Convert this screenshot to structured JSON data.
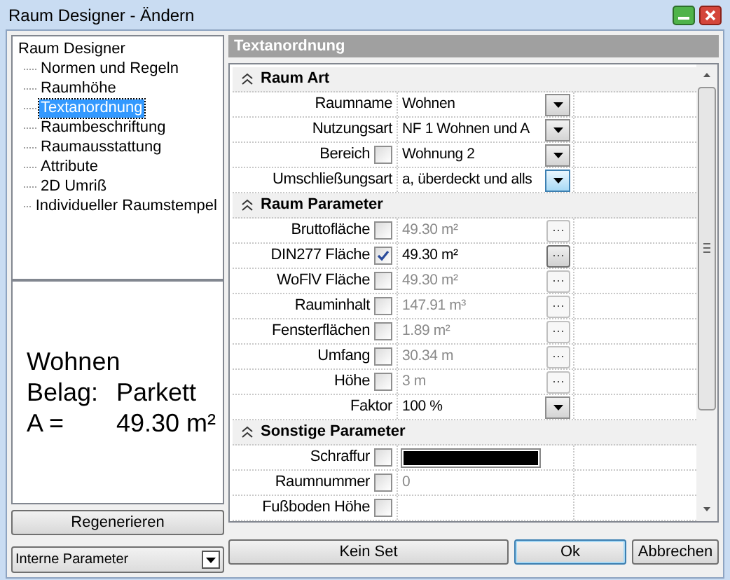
{
  "window": {
    "title": "Raum Designer - Ändern"
  },
  "tree": {
    "label": "Raum Designer",
    "selected": false,
    "children": [
      {
        "label": "Normen und Regeln",
        "selected": false
      },
      {
        "label": "Raumhöhe",
        "selected": false
      },
      {
        "label": "Textanordnung",
        "selected": true
      },
      {
        "label": "Raumbeschriftung",
        "selected": false
      },
      {
        "label": "Raumausstattung",
        "selected": false
      },
      {
        "label": "Attribute",
        "selected": false
      },
      {
        "label": "2D Umriß",
        "selected": false
      },
      {
        "label": "Individueller Raumstempel",
        "selected": false
      }
    ]
  },
  "preview": {
    "lines": [
      [
        "Wohnen"
      ],
      [
        "Belag:",
        "Parkett"
      ],
      [
        "A =",
        "49.30 m²"
      ]
    ]
  },
  "regenerate_button": "Regenerieren",
  "parameter_select": {
    "value": "Interne Parameter"
  },
  "panel_title": "Textanordnung",
  "grid": [
    {
      "kind": "section",
      "label": "Raum Art",
      "expanded": true
    },
    {
      "kind": "dropdown",
      "label": "Raumname",
      "value": "Wohnen",
      "dimmed": false,
      "active": false
    },
    {
      "kind": "dropdown",
      "label": "Nutzungsart",
      "value": "NF 1 Wohnen und A",
      "dimmed": false,
      "active": false
    },
    {
      "kind": "dropdown",
      "label": "Bereich",
      "checked": false,
      "value": "Wohnung 2",
      "dimmed": false,
      "active": false
    },
    {
      "kind": "dropdown",
      "label": "Umschließungsart",
      "value": "a, überdeckt und alls",
      "dimmed": false,
      "active": true
    },
    {
      "kind": "section",
      "label": "Raum Parameter",
      "expanded": true
    },
    {
      "kind": "ellipsis",
      "label": "Bruttofläche",
      "checked": false,
      "value": "49.30 m²",
      "dimmed": true,
      "active": false
    },
    {
      "kind": "ellipsis",
      "label": "DIN277 Fläche",
      "checked": true,
      "value": "49.30 m²",
      "dimmed": false,
      "active": true
    },
    {
      "kind": "ellipsis",
      "label": "WoFlV Fläche",
      "checked": false,
      "value": "49.30 m²",
      "dimmed": true,
      "active": false
    },
    {
      "kind": "ellipsis",
      "label": "Rauminhalt",
      "checked": false,
      "value": "147.91 m³",
      "dimmed": true,
      "active": false
    },
    {
      "kind": "ellipsis",
      "label": "Fensterflächen",
      "checked": false,
      "value": "1.89 m²",
      "dimmed": true,
      "active": false
    },
    {
      "kind": "ellipsis",
      "label": "Umfang",
      "checked": false,
      "value": "30.34 m",
      "dimmed": true,
      "active": false
    },
    {
      "kind": "ellipsis",
      "label": "Höhe",
      "checked": false,
      "value": "3 m",
      "dimmed": true,
      "active": false
    },
    {
      "kind": "dropdown",
      "label": "Faktor",
      "value": "100 %",
      "dimmed": false,
      "active": false
    },
    {
      "kind": "section",
      "label": "Sonstige Parameter",
      "expanded": true
    },
    {
      "kind": "color",
      "label": "Schraffur",
      "checked": false,
      "color": "#000000"
    },
    {
      "kind": "text",
      "label": "Raumnummer",
      "checked": false,
      "value": "0",
      "dimmed": true
    },
    {
      "kind": "text",
      "label": "Fußboden Höhe",
      "checked": false
    }
  ],
  "buttons": [
    {
      "label": "Kein Set",
      "default": false
    },
    {
      "label": "Ok",
      "default": true
    },
    {
      "label": "Abbrechen",
      "default": false
    }
  ]
}
